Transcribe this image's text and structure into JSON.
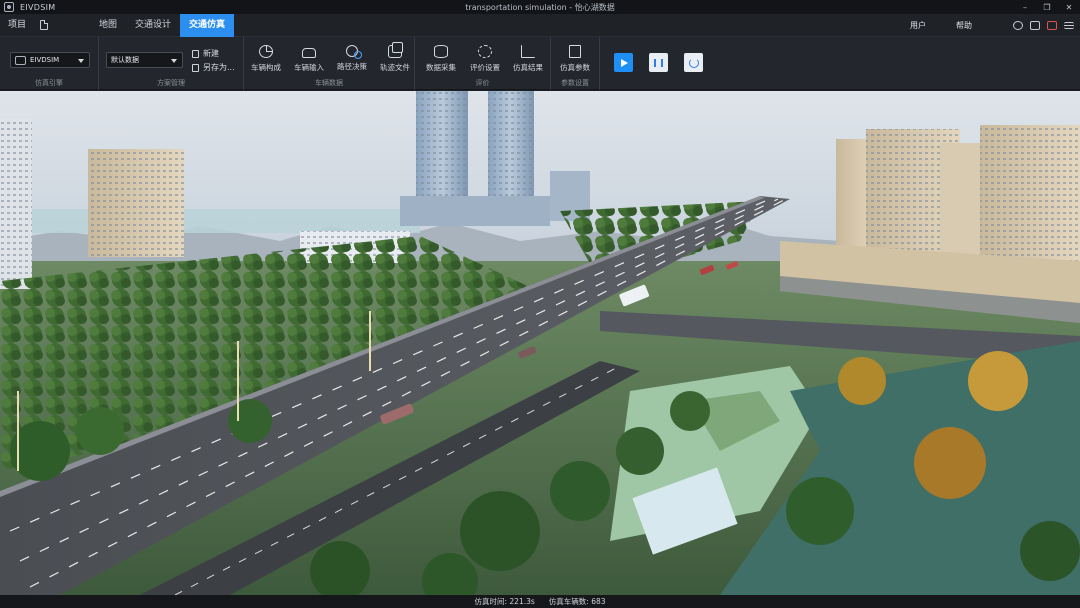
{
  "window": {
    "app_name": "EIVDSIM",
    "title": "transportation simulation - 怡心湖数据"
  },
  "menu": {
    "project": "项目",
    "tabs": [
      {
        "label": "地图",
        "active": false
      },
      {
        "label": "交通设计",
        "active": false
      },
      {
        "label": "交通仿真",
        "active": true
      }
    ],
    "user": "用户",
    "help": "帮助",
    "top_icons": [
      "pin-icon",
      "camera-icon",
      "video-icon",
      "list-icon"
    ]
  },
  "ribbon": {
    "engine_group": {
      "selected": "EIVDSIM",
      "label": "仿真引擎"
    },
    "scheme_group": {
      "selected": "默认数据",
      "new_label": "新建",
      "save_as_label": "另存为...",
      "label": "方案管理"
    },
    "vehicle_group": {
      "tools": [
        "车辆构成",
        "车辆输入",
        "路径决策",
        "轨迹文件"
      ],
      "label": "车辆数据"
    },
    "eval_group": {
      "tools": [
        "数据采集",
        "评价设置",
        "仿真结果"
      ],
      "label": "评价"
    },
    "params_group": {
      "tool": "仿真参数",
      "label": "参数设置"
    },
    "controls": [
      "play-icon",
      "pause-icon",
      "power-icon"
    ],
    "accent_color": "#2c8ff0"
  },
  "status": {
    "sim_time": "仿真时间: 221.3s",
    "vehicle_count": "仿真车辆数: 683"
  }
}
